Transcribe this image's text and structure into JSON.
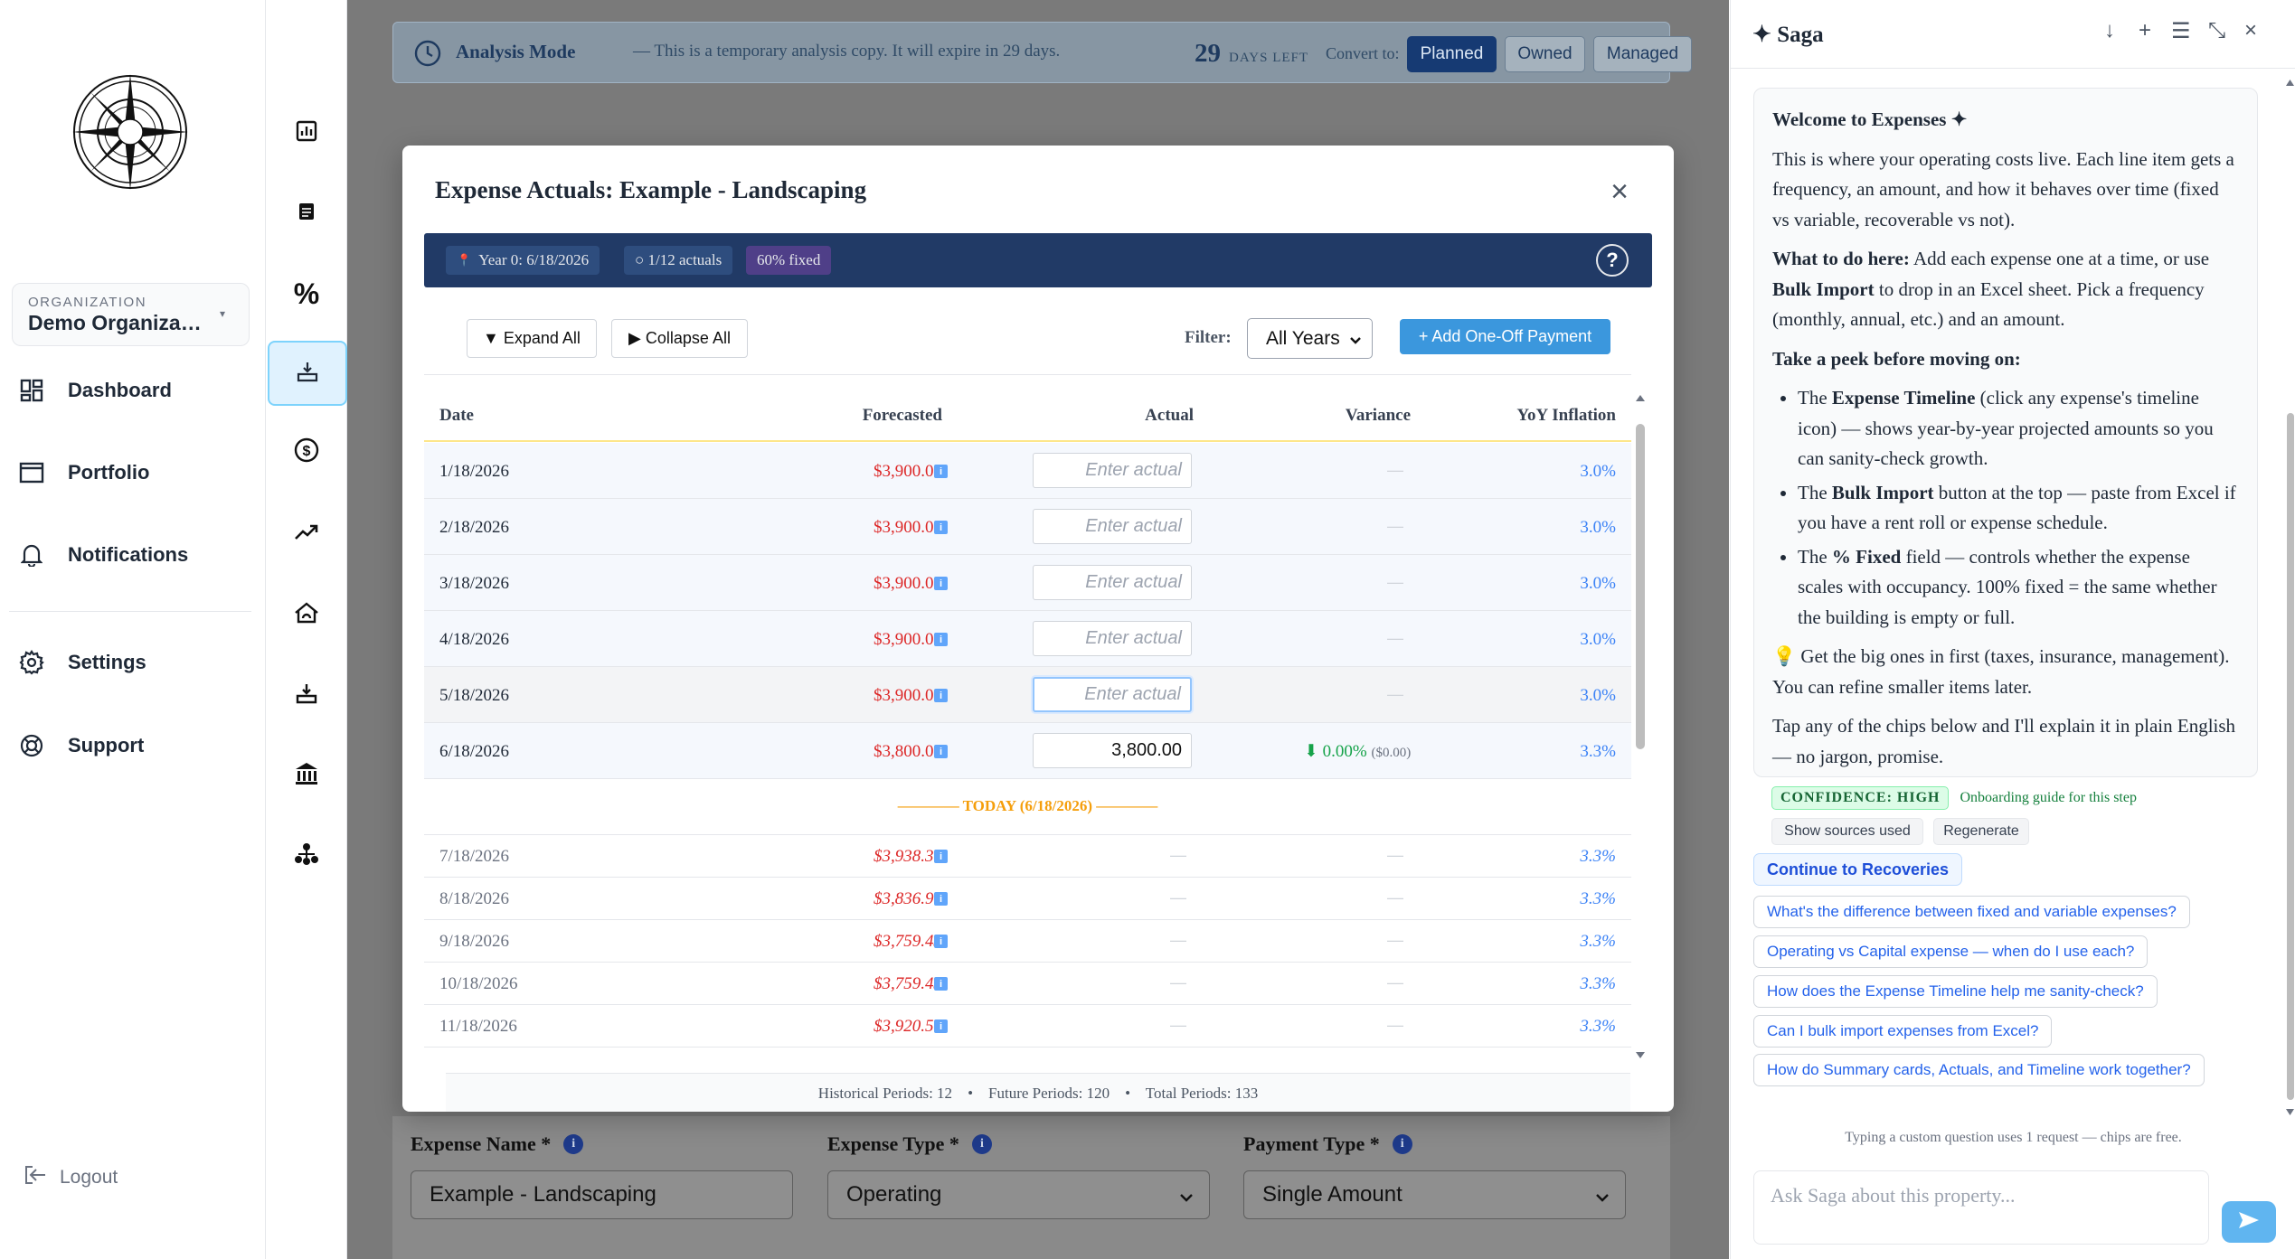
{
  "org": {
    "label": "ORGANIZATION",
    "name": "Demo Organiza…"
  },
  "nav": {
    "items": [
      {
        "label": "Dashboard",
        "icon": "dashboard-icon"
      },
      {
        "label": "Portfolio",
        "icon": "portfolio-icon"
      },
      {
        "label": "Notifications",
        "icon": "bell-icon"
      },
      {
        "label": "Settings",
        "icon": "gear-icon"
      },
      {
        "label": "Support",
        "icon": "lifebuoy-icon"
      }
    ],
    "logout": "Logout"
  },
  "rail": {
    "icons": [
      "bar-chart-icon",
      "document-icon",
      "percent-icon",
      "expense-tray-icon",
      "dollar-cycle-icon",
      "trend-up-icon",
      "house-icon",
      "tray-download-icon",
      "bank-icon",
      "org-chart-icon"
    ],
    "active_index": 3
  },
  "banner": {
    "title": "Analysis Mode",
    "message": "— This is a temporary analysis copy. It will expire in 29 days.",
    "days": "29",
    "days_label": "DAYS LEFT",
    "convert_label": "Convert to:",
    "buttons": [
      "Planned",
      "Owned",
      "Managed"
    ]
  },
  "form": {
    "expense_name_label": "Expense Name *",
    "expense_name_value": "Example - Landscaping",
    "expense_type_label": "Expense Type *",
    "expense_type_value": "Operating",
    "payment_type_label": "Payment Type *",
    "payment_type_value": "Single Amount"
  },
  "modal": {
    "title": "Expense Actuals: Example - Landscaping",
    "close": "×",
    "pills": [
      "Year 0: 6/18/2026",
      "○ 1/12 actuals",
      "60% fixed"
    ],
    "pill_icon": "📍",
    "help": "?",
    "toolbar": {
      "expand_all": "▼ Expand All",
      "collapse_all": "▶ Collapse All",
      "filter_label": "Filter:",
      "filter_value": "All Years",
      "add_one_off": "+ Add One-Off Payment"
    },
    "columns": [
      "Date",
      "Forecasted",
      "Actual",
      "Variance",
      "YoY Inflation"
    ],
    "actual_placeholder": "Enter actual",
    "dash": "—",
    "historical_rows": [
      {
        "date": "1/18/2026",
        "forecasted": "$3,900.00",
        "actual": "",
        "yoy": "3.0%"
      },
      {
        "date": "2/18/2026",
        "forecasted": "$3,900.00",
        "actual": "",
        "yoy": "3.0%"
      },
      {
        "date": "3/18/2026",
        "forecasted": "$3,900.00",
        "actual": "",
        "yoy": "3.0%"
      },
      {
        "date": "4/18/2026",
        "forecasted": "$3,900.00",
        "actual": "",
        "yoy": "3.0%"
      },
      {
        "date": "5/18/2026",
        "forecasted": "$3,900.00",
        "actual": "",
        "yoy": "3.0%"
      },
      {
        "date": "6/18/2026",
        "forecasted": "$3,800.00",
        "actual": "3,800.00",
        "variance": "⬇ 0.00%",
        "variance_sub": "($0.00)",
        "yoy": "3.3%"
      }
    ],
    "today_label": "———— TODAY (6/18/2026) ————",
    "future_rows": [
      {
        "date": "7/18/2026",
        "forecasted": "$3,938.39",
        "yoy": "3.3%"
      },
      {
        "date": "8/18/2026",
        "forecasted": "$3,836.97",
        "yoy": "3.3%"
      },
      {
        "date": "9/18/2026",
        "forecasted": "$3,759.43",
        "yoy": "3.3%"
      },
      {
        "date": "10/18/2026",
        "forecasted": "$3,759.43",
        "yoy": "3.3%"
      },
      {
        "date": "11/18/2026",
        "forecasted": "$3,920.57",
        "yoy": "3.3%"
      }
    ],
    "footer": {
      "historical": "Historical Periods: 12",
      "future": "Future Periods: 120",
      "total": "Total Periods: 133",
      "sep": "•"
    }
  },
  "saga": {
    "title": "Saga",
    "message": {
      "heading": "Welcome to Expenses ✦",
      "intro": "This is where your operating costs live. Each line item gets a frequency, an amount, and how it behaves over time (fixed vs variable, recoverable vs not).",
      "what_label": "What to do here:",
      "what_a": " Add each expense one at a time, or use ",
      "what_bold": "Bulk Import",
      "what_b": " to drop in an Excel sheet. Pick a frequency (monthly, annual, etc.) and an amount.",
      "peek": "Take a peek before moving on:",
      "b1_pre": "The ",
      "b1_bold": "Expense Timeline",
      "b1_post": " (click any expense's timeline icon) — shows year-by-year projected amounts so you can sanity-check growth.",
      "b2_pre": "The ",
      "b2_bold": "Bulk Import",
      "b2_post": " button at the top — paste from Excel if you have a rent roll or expense schedule.",
      "b3_pre": "The ",
      "b3_bold": "% Fixed",
      "b3_post": " field — controls whether the expense scales with occupancy. 100% fixed = the same whether the building is empty or full.",
      "tip": "💡  Get the big ones in first (taxes, insurance, management). You can refine smaller items later.",
      "outro": "Tap any of the chips below and I'll explain it in plain English — no jargon, promise."
    },
    "confidence": "CONFIDENCE: HIGH",
    "confidence_note": "Onboarding guide for this step",
    "show_sources": "Show sources used",
    "regenerate": "Regenerate",
    "continue": "Continue to Recoveries",
    "chips": [
      "What's the difference between fixed and variable expenses?",
      "Operating vs Capital expense — when do I use each?",
      "How does the Expense Timeline help me sanity-check?",
      "Can I bulk import expenses from Excel?",
      "How do Summary cards, Actuals, and Timeline work together?"
    ],
    "note": "Typing a custom question uses 1 request — chips are free.",
    "input_placeholder": "Ask Saga about this property..."
  }
}
